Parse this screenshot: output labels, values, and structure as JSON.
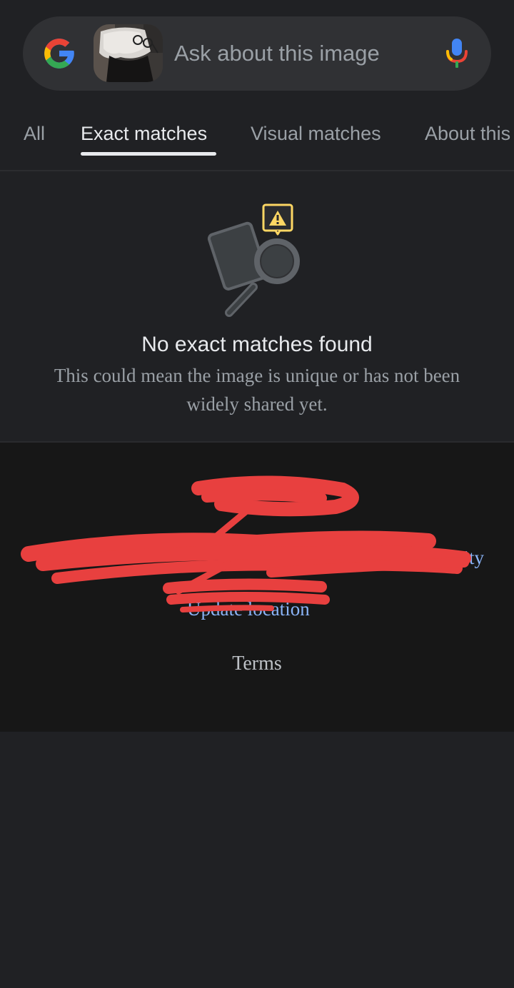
{
  "search": {
    "placeholder": "Ask about this image",
    "query_thumbnail": "uploaded-photo"
  },
  "icons": {
    "logo": "google-g-icon",
    "mic": "microphone-icon",
    "illustration": "search-document-warning-icon"
  },
  "tabs": [
    {
      "label": "All",
      "active": false
    },
    {
      "label": "Exact matches",
      "active": true
    },
    {
      "label": "Visual matches",
      "active": false
    },
    {
      "label": "About this image",
      "active": false
    }
  ],
  "empty_state": {
    "title": "No exact matches found",
    "description": "This could mean the image is unique or has not been widely shared yet."
  },
  "footer": {
    "partial_link_right": "vity",
    "partial_link_location": "Update location",
    "terms": "Terms",
    "redaction_color": "#e8403f"
  },
  "colors": {
    "background": "#202124",
    "search_bar": "#303134",
    "footer_background": "#171717",
    "link": "#8ab4f8",
    "warning": "#fdd663"
  }
}
